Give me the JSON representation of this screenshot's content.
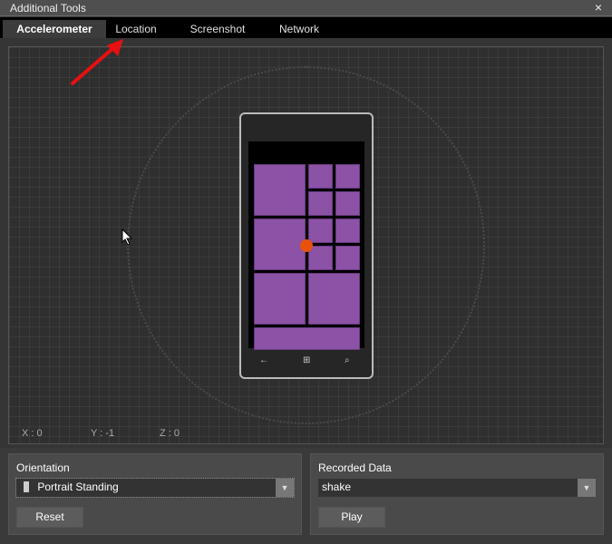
{
  "window": {
    "title": "Additional Tools",
    "close_icon": "×"
  },
  "tabs": [
    {
      "label": "Accelerometer",
      "active": true
    },
    {
      "label": "Location",
      "active": false
    },
    {
      "label": "Screenshot",
      "active": false
    },
    {
      "label": "Network",
      "active": false
    }
  ],
  "accelerometer": {
    "x_label": "X : 0",
    "y_label": "Y : -1",
    "z_label": "Z : 0"
  },
  "phone": {
    "tile_color": "#8b52a6",
    "dot_color": "#e8520c",
    "nav_icons": [
      "back-icon",
      "windows-icon",
      "search-icon"
    ]
  },
  "orientation": {
    "label": "Orientation",
    "selected": "Portrait Standing",
    "reset_label": "Reset"
  },
  "recorded": {
    "label": "Recorded Data",
    "selected": "shake",
    "play_label": "Play"
  },
  "annotation": {
    "arrow_color": "#e81010"
  }
}
